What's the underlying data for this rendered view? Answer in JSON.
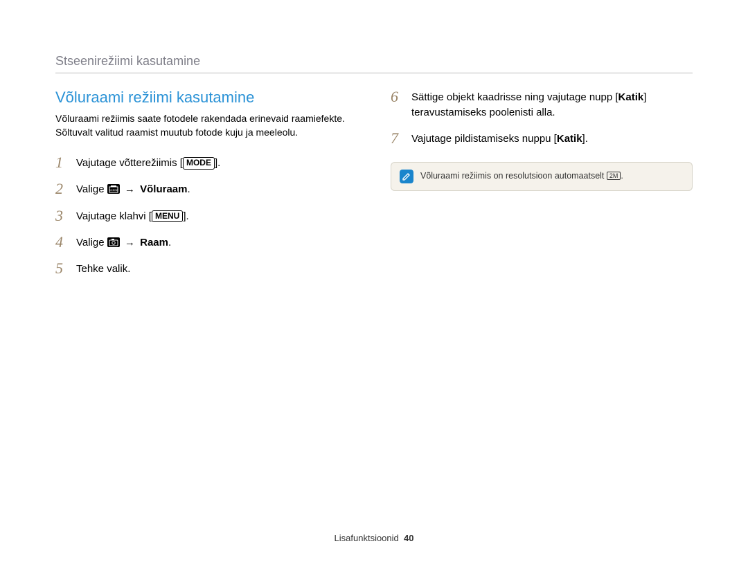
{
  "sectionTitle": "Stseenirežiimi kasutamine",
  "heading": "Võluraami režiimi kasutamine",
  "intro": "Võluraami režiimis saate fotodele rakendada erinevaid raamiefekte. Sõltuvalt valitud raamist muutub fotode kuju ja meeleolu.",
  "steps": {
    "s1": {
      "num": "1",
      "pre": "Vajutage võtterežiimis [",
      "chip": "MODE",
      "post": "]."
    },
    "s2": {
      "num": "2",
      "pre": "Valige ",
      "arrow": " → ",
      "strong": "Võluraam",
      "post": "."
    },
    "s3": {
      "num": "3",
      "pre": "Vajutage klahvi [",
      "chip": "MENU",
      "post": "]."
    },
    "s4": {
      "num": "4",
      "pre": "Valige ",
      "arrow": " → ",
      "strong": "Raam",
      "post": "."
    },
    "s5": {
      "num": "5",
      "text": "Tehke valik."
    },
    "s6": {
      "num": "6",
      "pre": "Sättige objekt kaadrisse ning vajutage nupp [",
      "strong": "Katik",
      "post": "] teravustamiseks poolenisti alla."
    },
    "s7": {
      "num": "7",
      "pre": "Vajutage pildistamiseks nuppu [",
      "strong": "Katik",
      "post": "]."
    }
  },
  "note": {
    "pre": "Võluraami režiimis on resolutsioon automaatselt ",
    "res": "2M",
    "post": "."
  },
  "footer": {
    "label": "Lisafunktsioonid",
    "page": "40"
  }
}
